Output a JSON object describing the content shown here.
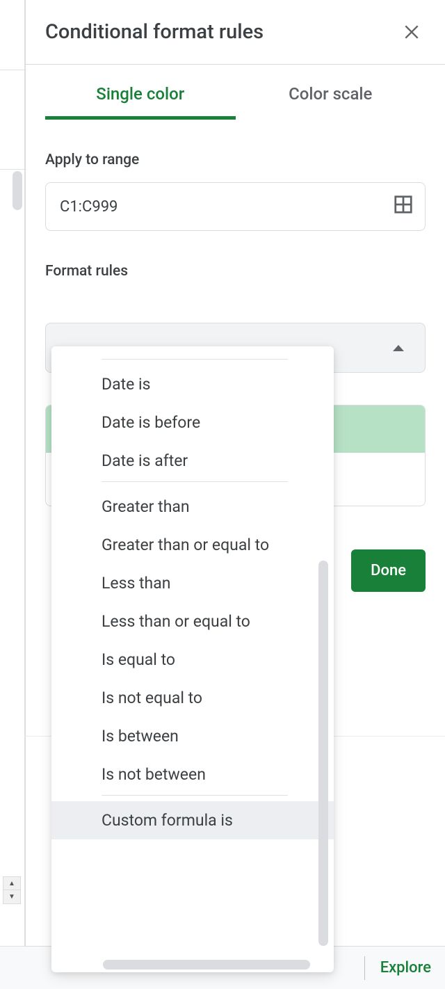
{
  "panel": {
    "title": "Conditional format rules",
    "tabs": {
      "single_color": "Single color",
      "color_scale": "Color scale"
    },
    "apply_to_range_label": "Apply to range",
    "range_value": "C1:C999",
    "format_rules_label": "Format rules",
    "done_label": "Done",
    "preview_color": "#b6e1c5"
  },
  "dropdown": {
    "items_group1": [
      "Date is",
      "Date is before",
      "Date is after"
    ],
    "items_group2": [
      "Greater than",
      "Greater than or equal to",
      "Less than",
      "Less than or equal to",
      "Is equal to",
      "Is not equal to",
      "Is between",
      "Is not between"
    ],
    "items_group3": [
      "Custom formula is"
    ],
    "highlighted": "Custom formula is"
  },
  "footer": {
    "explore": "Explore"
  }
}
